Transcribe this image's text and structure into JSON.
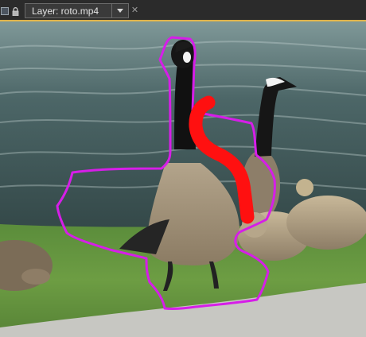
{
  "layer_panel": {
    "layer_label": "Layer: roto.mp4",
    "close_glyph": "✕",
    "icons": [
      "panel-icon",
      "lock-icon",
      "chevron-down-icon"
    ]
  },
  "colors": {
    "toolbar_bg": "#2b2b2b",
    "tab_border": "#6a6a6a",
    "accent_line": "#e0b34a",
    "mask_path": "#d61ee8",
    "roto_stroke": "#ff1010"
  }
}
